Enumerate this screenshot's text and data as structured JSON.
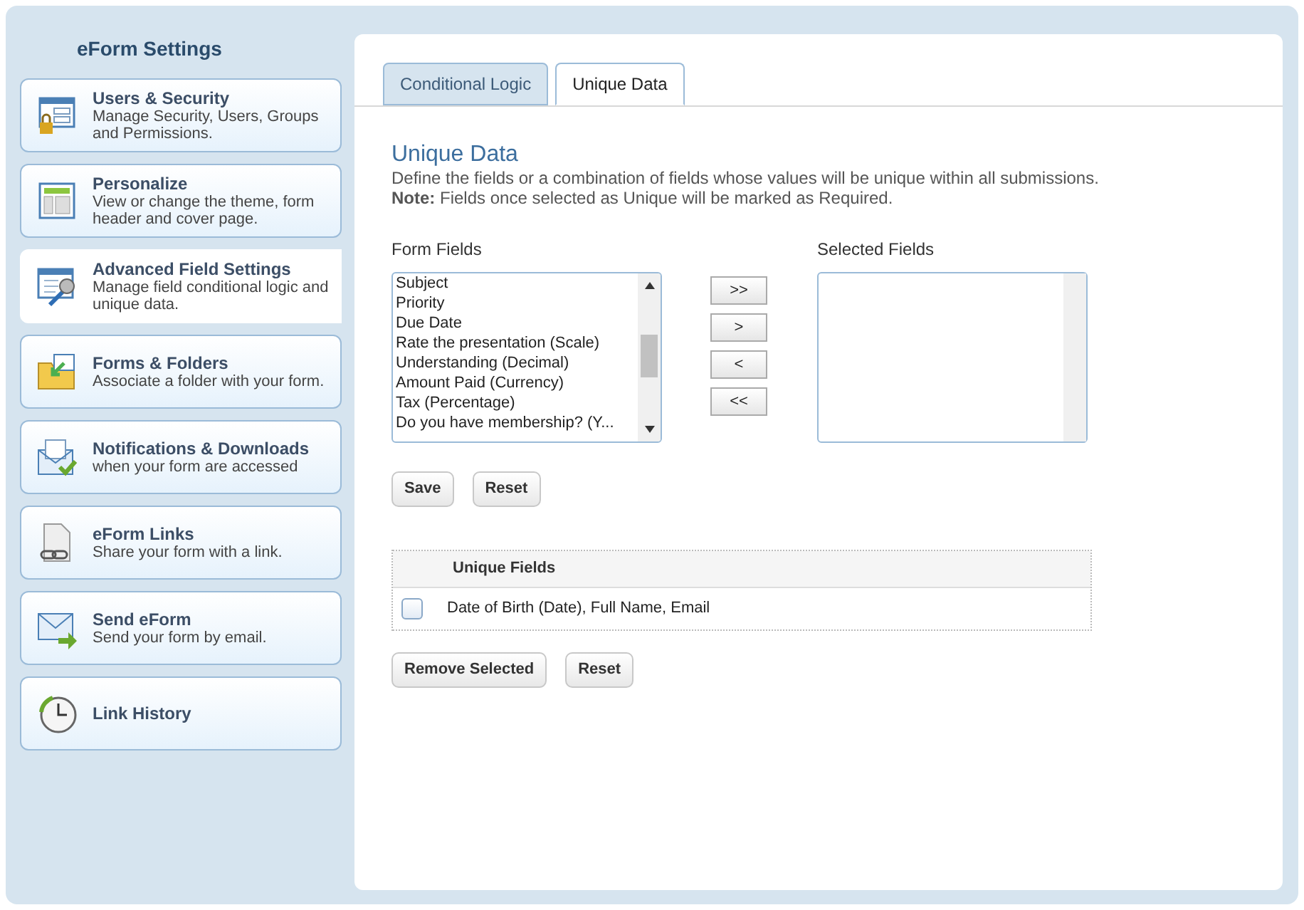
{
  "sidebar": {
    "title": "eForm Settings",
    "items": [
      {
        "title": "Users & Security",
        "description": "Manage Security, Users, Groups and Permissions.",
        "selected": false
      },
      {
        "title": "Personalize",
        "description": "View or change the theme, form header and cover page.",
        "selected": false
      },
      {
        "title": "Advanced Field Settings",
        "description": "Manage field conditional logic and unique data.",
        "selected": true
      },
      {
        "title": "Forms & Folders",
        "description": "Associate a folder with your form.",
        "selected": false
      },
      {
        "title": "Notifications & Downloads",
        "description": "when your form are accessed",
        "selected": false
      },
      {
        "title": "eForm Links",
        "description": "Share your form with a link.",
        "selected": false
      },
      {
        "title": "Send eForm",
        "description": "Send your form by email.",
        "selected": false
      },
      {
        "title": "Link History",
        "selected": false
      }
    ]
  },
  "tabs": [
    {
      "label": "Conditional Logic",
      "selected": false
    },
    {
      "label": "Unique Data",
      "selected": true
    }
  ],
  "heading": "Unique Data",
  "description": "Define the fields or a combination of fields whose values will be unique within all submissions.",
  "note": "**Note:** Fields once selected as Unique will be marked as Required.",
  "form_fields": {
    "label": "Form Fields",
    "options": [
      "Subject",
      "Priority",
      "Due Date",
      "Rate the presentation (Scale)",
      "Understanding (Decimal)",
      "Amount Paid (Currency)",
      "Tax (Percentage)",
      "Do you have membership? (Y..."
    ]
  },
  "move_buttons": [
    ">>",
    ">",
    "<",
    "<<"
  ],
  "selected_fields": {
    "label": "Selected Fields"
  },
  "form_buttons": [
    "Save",
    "Reset"
  ],
  "unique_table": {
    "columns": [
      "Unique Fields"
    ],
    "rows": [
      {
        "value": "Date of Birth (Date), Full Name, Email",
        "checked": false
      }
    ]
  },
  "table_buttons": [
    "Remove Selected",
    "Reset"
  ]
}
